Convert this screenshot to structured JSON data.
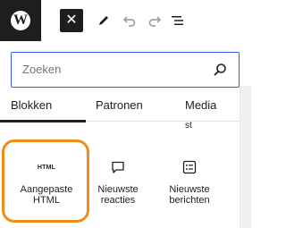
{
  "toolbar": {
    "logo_letter": "W",
    "close_glyph": "✕",
    "icons": [
      "wordpress-logo",
      "close-icon",
      "pen-icon",
      "undo-icon",
      "redo-icon",
      "document-overview-icon"
    ]
  },
  "search": {
    "placeholder": "Zoeken",
    "value": ""
  },
  "tabs": [
    {
      "label": "Blokken",
      "active": true
    },
    {
      "label": "Patronen",
      "active": false
    },
    {
      "label": "Media",
      "active": false
    }
  ],
  "clipped_text": "st",
  "blocks": [
    {
      "icon_text": "HTML",
      "label_line1": "Aangepaste",
      "label_line2": "HTML",
      "highlighted": true
    },
    {
      "icon": "comment-icon",
      "label_line1": "Nieuwste",
      "label_line2": "reacties"
    },
    {
      "icon": "post-list-icon",
      "label_line1": "Nieuwste",
      "label_line2": "berichten"
    }
  ],
  "colors": {
    "accent": "#3858e9",
    "highlight": "#f08c1c",
    "dark": "#1e1e1e",
    "disabled": "#949494"
  }
}
